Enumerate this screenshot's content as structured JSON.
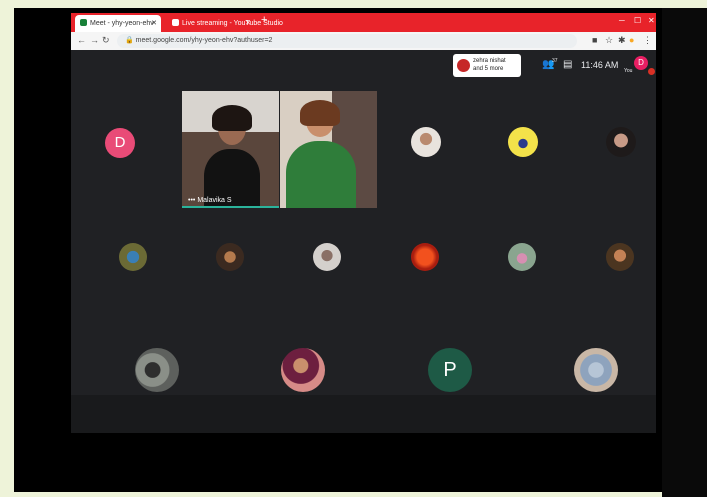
{
  "browser": {
    "tabs": [
      {
        "label": "Meet - yhy-yeon-ehv",
        "favicon_color": "#188038"
      },
      {
        "label": "Live streaming - YouTube Studio",
        "favicon_color": "#ffffff"
      }
    ],
    "new_tab": "+",
    "url": "meet.google.com/yhy-yeon-ehv?authuser=2"
  },
  "meet": {
    "presenter_line1": "zehra nishat",
    "presenter_line2": "and 5 more",
    "people_count": "37",
    "time": "11:46 AM",
    "you_label": "You",
    "self_initial": "D",
    "active_speaker": "Malavika S",
    "participants": {
      "d_initial": "D",
      "p_initial": "P"
    }
  },
  "colors": {
    "accent_chrome": "#e8232a",
    "meet_bg": "#202124",
    "avatar_d": "#e94b77",
    "avatar_p": "#1e5a46",
    "speaking": "#2bb39b"
  }
}
